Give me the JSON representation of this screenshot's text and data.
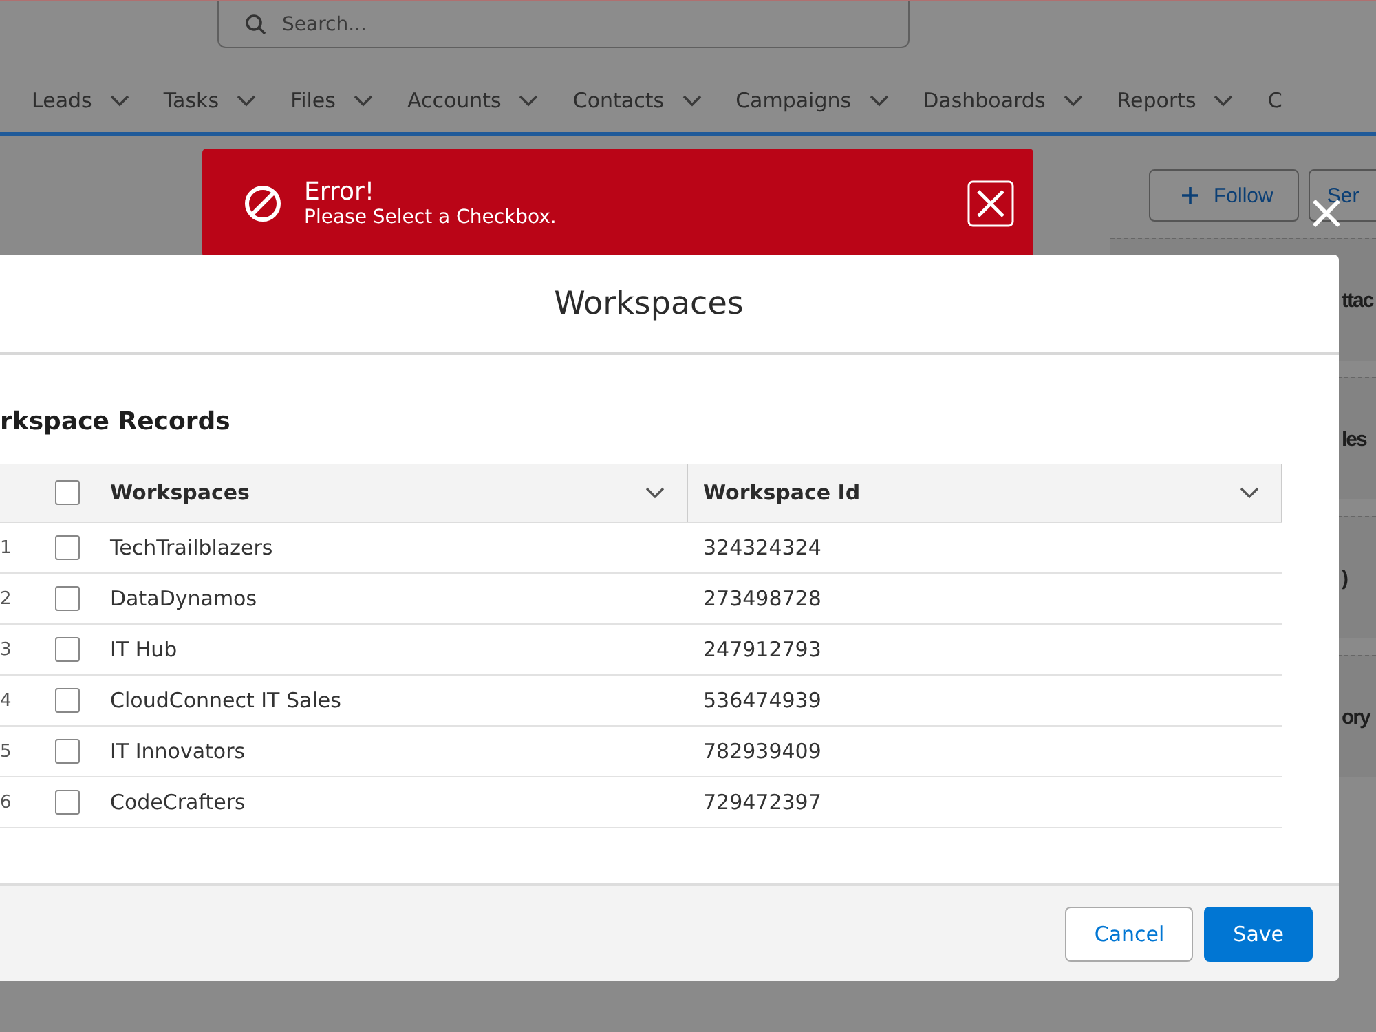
{
  "search": {
    "placeholder": "Search..."
  },
  "nav": [
    {
      "label": "Leads"
    },
    {
      "label": "Tasks"
    },
    {
      "label": "Files"
    },
    {
      "label": "Accounts"
    },
    {
      "label": "Contacts"
    },
    {
      "label": "Campaigns"
    },
    {
      "label": "Dashboards"
    },
    {
      "label": "Reports"
    },
    {
      "label": "C"
    }
  ],
  "header_buttons": [
    {
      "label": "Follow"
    },
    {
      "label": "Ser"
    }
  ],
  "side_cards": [
    {
      "text": "ttac"
    },
    {
      "text": "les"
    },
    {
      "text": ")"
    },
    {
      "text": "ory"
    }
  ],
  "toast": {
    "title": "Error!",
    "message": "Please Select a Checkbox."
  },
  "modal": {
    "title": "Workspaces",
    "section": "rkspace Records",
    "table": {
      "columns": [
        "Workspaces",
        "Workspace Id"
      ],
      "all_checked": false,
      "rows": [
        {
          "n": "1",
          "checked": false,
          "cells": [
            "TechTrailblazers",
            "324324324"
          ]
        },
        {
          "n": "2",
          "checked": false,
          "cells": [
            "DataDynamos",
            "273498728"
          ]
        },
        {
          "n": "3",
          "checked": false,
          "cells": [
            "IT Hub",
            "247912793"
          ]
        },
        {
          "n": "4",
          "checked": false,
          "cells": [
            "CloudConnect IT Sales",
            "536474939"
          ]
        },
        {
          "n": "5",
          "checked": false,
          "cells": [
            "IT Innovators",
            "782939409"
          ]
        },
        {
          "n": "6",
          "checked": false,
          "cells": [
            "CodeCrafters",
            "729472397"
          ]
        }
      ]
    },
    "buttons": [
      {
        "label": "Cancel",
        "kind": "neutral"
      },
      {
        "label": "Save",
        "kind": "brand"
      }
    ]
  }
}
